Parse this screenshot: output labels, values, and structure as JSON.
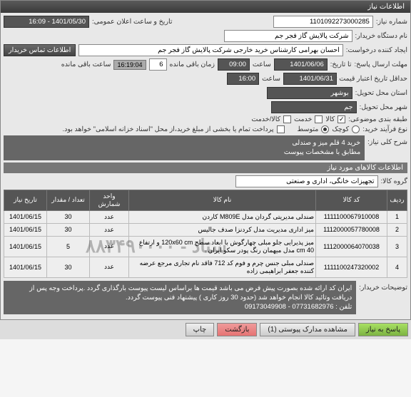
{
  "header": {
    "title": "اطلاعات نیاز"
  },
  "fields": {
    "need_no_label": "شماره نیاز:",
    "need_no": "1101092273000285",
    "announce_label": "تاریخ و ساعت اعلان عمومی:",
    "announce": "1401/05/30 - 16:09",
    "buyer_label": "نام دستگاه خریدار:",
    "buyer": "شرکت پالایش گاز فجر جم",
    "requester_label": "ایجاد کننده درخواست:",
    "requester": "احسان بهرامی کارشناس خرید خارجی شرکت پالایش گاز فجر جم",
    "contact_btn": "اطلاعات تماس خریدار",
    "deadline_label": "مهلت ارسال پاسخ:",
    "deadline_date_label": "تا تاریخ:",
    "deadline_date": "1401/06/06",
    "time_label": "ساعت",
    "deadline_time": "09:00",
    "remain_label": "زمان باقی مانده",
    "remain_days": "6",
    "remain_time": "16:19:04",
    "remain_suffix": "ساعت باقی مانده",
    "validity_label": "حداقل تاریخ اعتبار قیمت تا تاریخ:",
    "validity_date": "1401/06/31",
    "validity_time": "16:00",
    "province_label": "استان محل تحویل:",
    "province": "بوشهر",
    "city_label": "شهر محل تحویل:",
    "city": "جم",
    "category_label": "طبقه بندی موضوعی:",
    "cat_goods": "کالا",
    "cat_service": "خدمت",
    "cat_both": "کالا/خدمت",
    "process_label": "نوع فرآیند خرید:",
    "proc_low": "کوچک",
    "proc_mid": "متوسط",
    "pay_note": "پرداخت تمام یا بخشی از مبلغ خرید،از محل \"اسناد خزانه اسلامی\" خواهد بود."
  },
  "desc": {
    "label": "شرح کلی نیاز:",
    "line1": "خرید 4 قلم میز و صندلی",
    "line2": "مطابق با مشخصات پیوست"
  },
  "goods": {
    "title": "اطلاعات کالاهای مورد نیاز",
    "group_label": "گروه کالا:",
    "group": "تجهیزات خانگی، اداری و صنعتی",
    "headers": {
      "row": "ردیف",
      "code": "کد کالا",
      "name": "نام کالا",
      "unit": "واحد شمارش",
      "qty": "تعداد / مقدار",
      "date": "تاریخ نیاز"
    },
    "rows": [
      {
        "n": "1",
        "code": "1111100067910008",
        "name": "صندلی مدیریتی گردان مدل M809E کاردن",
        "unit": "عدد",
        "qty": "30",
        "date": "1401/06/15"
      },
      {
        "n": "2",
        "code": "1112000057780008",
        "name": "میز اداری مدیریت مدل کردنزا صدف جالیس",
        "unit": "عدد",
        "qty": "30",
        "date": "1401/06/15"
      },
      {
        "n": "3",
        "code": "1112000064070038",
        "name": "میز پذیرایی جلو مبلی چهارگوش با ابعاد سطح 120x60 cm و ارتفاع 40 cm مدل میهمان رنگ پودر سکو ایران",
        "unit": "عدد",
        "qty": "5",
        "date": "1401/06/15"
      },
      {
        "n": "4",
        "code": "1111100247320002",
        "name": "صندلی مبلی جنس چرم و فوم کد 712 فاقد نام تجاری مرجع عرضه کننده جعفر ابراهیمی زاده",
        "unit": "عدد",
        "qty": "30",
        "date": "1401/06/15"
      }
    ]
  },
  "buyer_notes": {
    "label": "توضیحات خریدار:",
    "text": "ایران کد ارائه شده بصورت پیش فرض می باشد قیمت ها براساس لیست پیوست بارگذاری گردد .پرداخت وجه پس از دریافت وتائید کالا انجام خواهد شد (حدود 30 روز کاری ) پیشنهاد فنی پیوست گردد.",
    "phone": "تلفن : 07731682976 - 09173049908"
  },
  "footer": {
    "reply": "پاسخ به نیاز",
    "attach": "مشاهده مدارک پیوستی (1)",
    "back": "بازگشت",
    "print": "چاپ"
  },
  "watermark": "ستاد - ۸۸۳۴۹۰۰۰۰"
}
